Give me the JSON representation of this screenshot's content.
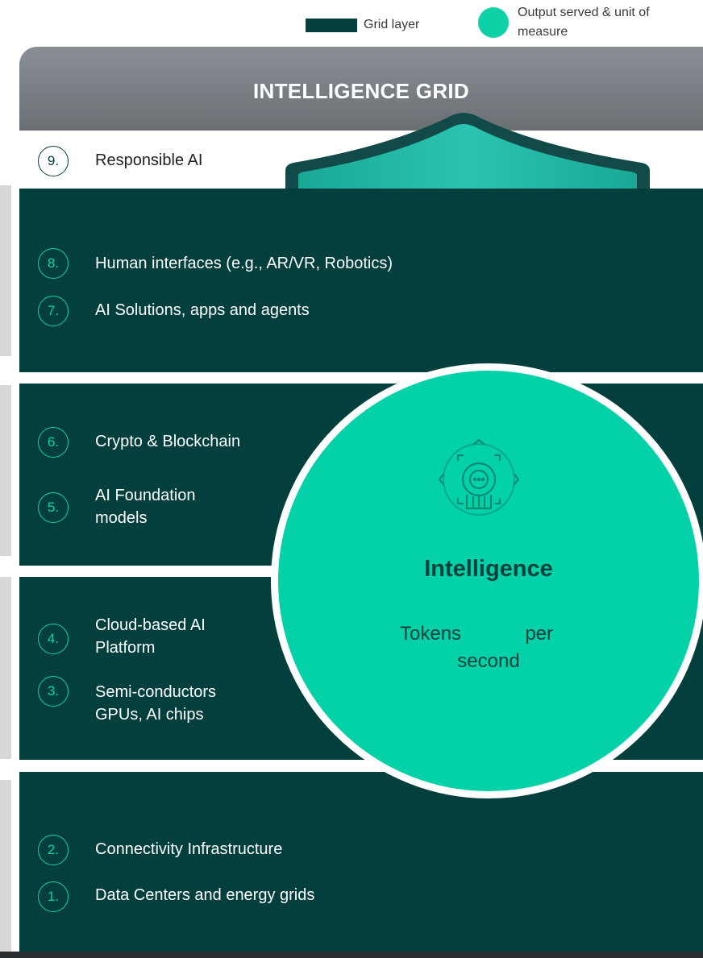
{
  "legend": {
    "grid_layer_label": "Grid layer",
    "output_label": "Output served & unit of measure"
  },
  "header": {
    "title": "INTELLIGENCE GRID"
  },
  "items": [
    {
      "number": "9.",
      "label": "Responsible AI"
    },
    {
      "number": "8.",
      "label": "Human interfaces (e.g., AR/VR, Robotics)"
    },
    {
      "number": "7.",
      "label": "AI Solutions, apps and agents"
    },
    {
      "number": "6.",
      "label": "Crypto & Blockchain"
    },
    {
      "number": "5.",
      "label": "AI Foundation models"
    },
    {
      "number": "4.",
      "label": "Cloud-based AI Platform"
    },
    {
      "number": "3.",
      "label": "Semi-conductors GPUs, AI chips"
    },
    {
      "number": "2.",
      "label": "Connectivity Infrastructure"
    },
    {
      "number": "1.",
      "label": "Data Centers and energy grids"
    }
  ],
  "circle": {
    "title": "Intelligence",
    "unit_word_1": "Tokens",
    "unit_word_2": "per",
    "unit_word_3": "second",
    "icon": "ai-brain-chip-icon"
  },
  "colors": {
    "band": "#033f3d",
    "accent": "#0fd1a8",
    "header": "#6f7479"
  }
}
